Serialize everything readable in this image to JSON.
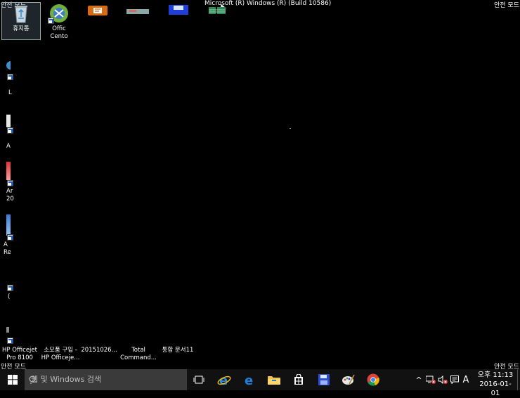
{
  "corner_text": {
    "top_left": "안전 모드",
    "top_right": "안전 모드",
    "bottom_left": "안전 모드",
    "bottom_right": "안전 모드"
  },
  "build_info": "Microsoft (R) Windows (R) (Build 10586)",
  "desktop_top_icons": [
    {
      "name": "recycle-bin",
      "label": "휴지통",
      "icon": "recycle-bin-icon"
    },
    {
      "name": "office-center",
      "label": "Offic\nCento",
      "icon": "office-center-icon"
    },
    {
      "name": "office-app",
      "label": "",
      "icon": "office-app-icon"
    },
    {
      "name": "image-app",
      "label": "",
      "icon": "image-app-icon"
    },
    {
      "name": "save-app",
      "label": "",
      "icon": "floppy-disk-icon"
    },
    {
      "name": "spreadsheet-app",
      "label": "",
      "icon": "spreadsheet-icon"
    }
  ],
  "desktop_left_fragments": [
    {
      "label": "L"
    },
    {
      "label": "A"
    },
    {
      "label": "Ar\n20"
    },
    {
      "label": "A\nRe"
    },
    {
      "label": "("
    },
    {
      "label": ""
    }
  ],
  "desktop_bottom_icons": [
    {
      "label": "HP Officejet\nPro 8100"
    },
    {
      "label": "소모품 구입 -\nHP Officeje..."
    },
    {
      "label": "20151026..."
    },
    {
      "label": "Total\nCommand..."
    },
    {
      "label": "통합 문서11"
    }
  ],
  "taskbar": {
    "search_placeholder": "웹 및 Windows 검색",
    "apps": [
      "start-icon",
      "task-view-icon",
      "internet-explorer-icon",
      "edge-icon",
      "file-explorer-icon",
      "store-icon",
      "floppy-disk-icon",
      "paint-icon",
      "chrome-icon"
    ],
    "tray": {
      "chevron": "^",
      "ime": "A",
      "clock_time": "오후 11:13",
      "clock_date": "2016-01-01"
    }
  },
  "colors": {
    "desktop_bg": "#000000",
    "taskbar_bg": "#111111",
    "search_bg": "#3a3a3a",
    "accent_blue": "#1e5ec8"
  }
}
